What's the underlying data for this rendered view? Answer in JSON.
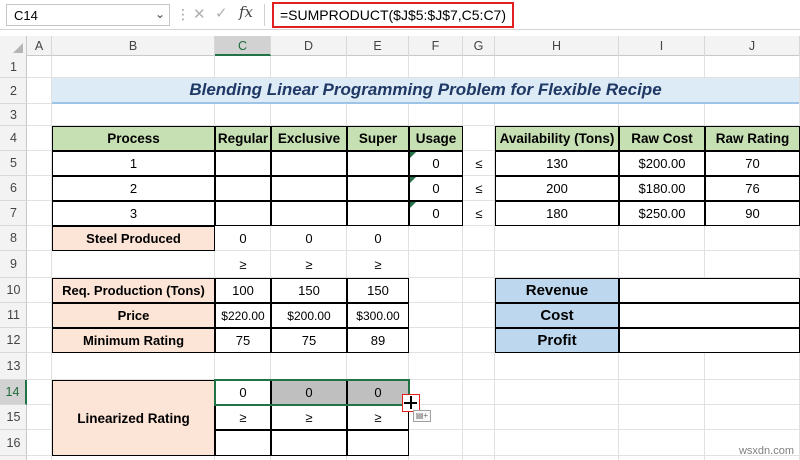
{
  "formula_bar": {
    "name_box": "C14",
    "formula": "=SUMPRODUCT($J$5:$J$7,C5:C7)",
    "fx_label": "fx",
    "cancel_icon": "✕",
    "enter_icon": "✓"
  },
  "columns": [
    "A",
    "B",
    "C",
    "D",
    "E",
    "F",
    "G",
    "H",
    "I",
    "J"
  ],
  "rows": [
    "1",
    "2",
    "3",
    "4",
    "5",
    "6",
    "7",
    "8",
    "9",
    "10",
    "11",
    "12",
    "13",
    "14",
    "15",
    "16"
  ],
  "selected": {
    "column": "C",
    "row": "14"
  },
  "title": "Blending Linear Programming Problem for Flexible Recipe",
  "process_table": {
    "headers": [
      "Process",
      "Regular",
      "Exclusive",
      "Super",
      "Usage"
    ],
    "rows": [
      {
        "process": "1",
        "usage": "0",
        "leq": "≤"
      },
      {
        "process": "2",
        "usage": "0",
        "leq": "≤"
      },
      {
        "process": "3",
        "usage": "0",
        "leq": "≤"
      }
    ],
    "steel_produced": {
      "label": "Steel Produced",
      "values": [
        "0",
        "0",
        "0"
      ]
    },
    "geq_row": [
      "≥",
      "≥",
      "≥"
    ]
  },
  "raw_table": {
    "headers": [
      "Availability (Tons)",
      "Raw Cost",
      "Raw Rating"
    ],
    "rows": [
      [
        "130",
        "$200.00",
        "70"
      ],
      [
        "200",
        "$180.00",
        "76"
      ],
      [
        "180",
        "$250.00",
        "90"
      ]
    ]
  },
  "requirements": {
    "rows": [
      {
        "label": "Req. Production (Tons)",
        "values": [
          "100",
          "150",
          "150"
        ]
      },
      {
        "label": "Price",
        "values": [
          "$220.00",
          "$200.00",
          "$300.00"
        ]
      },
      {
        "label": "Minimum Rating",
        "values": [
          "75",
          "75",
          "89"
        ]
      }
    ]
  },
  "summary": {
    "labels": [
      "Revenue",
      "Cost",
      "Profit"
    ]
  },
  "linearized": {
    "label": "Linearized Rating",
    "values": [
      "0",
      "0",
      "0"
    ],
    "geq_row": [
      "≥",
      "≥",
      "≥"
    ]
  },
  "watermark": "wsxdn.com",
  "colors": {
    "header_green": "#c6e0b4",
    "peach": "#fce4d6",
    "blue": "#bdd7ee",
    "selection": "#217346",
    "highlight_red": "#e0201e"
  }
}
